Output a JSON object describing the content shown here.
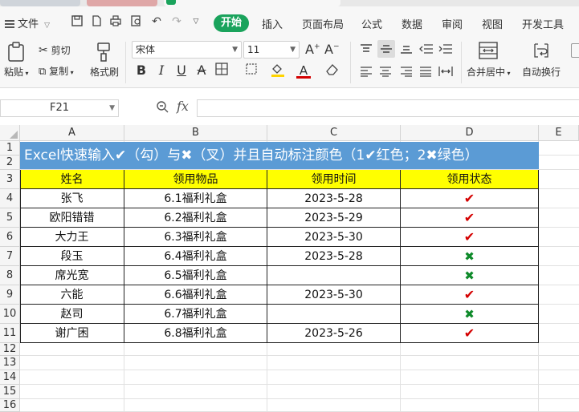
{
  "menu": {
    "file": "文件",
    "items": [
      "插入",
      "页面布局",
      "公式",
      "数据",
      "审阅",
      "视图",
      "开发工具"
    ],
    "active": "开始"
  },
  "ribbon": {
    "paste": "粘贴",
    "cut": "剪切",
    "copy": "复制",
    "format_painter": "格式刷",
    "font_name": "宋体",
    "font_size": "11",
    "merge_center": "合并居中",
    "wrap_text": "自动换行"
  },
  "formula_bar": {
    "name_box": "F21",
    "fx": "fx",
    "value": ""
  },
  "columns": [
    "A",
    "B",
    "C",
    "D",
    "E"
  ],
  "rows": [
    "1",
    "2",
    "3",
    "4",
    "5",
    "6",
    "7",
    "8",
    "9",
    "10",
    "11",
    "12",
    "13",
    "14",
    "15",
    "16"
  ],
  "sheet": {
    "title": "Excel快速输入✔（勾）与✖（叉）并且自动标注颜色（1✔红色；2✖绿色）",
    "headers": [
      "姓名",
      "领用物品",
      "领用时间",
      "领用状态"
    ],
    "records": [
      {
        "name": "张飞",
        "item": "6.1福利礼盒",
        "date": "2023-5-28",
        "status": "✔"
      },
      {
        "name": "欧阳错错",
        "item": "6.2福利礼盒",
        "date": "2023-5-29",
        "status": "✔"
      },
      {
        "name": "大力王",
        "item": "6.3福利礼盒",
        "date": "2023-5-30",
        "status": "✔"
      },
      {
        "name": "段玉",
        "item": "6.4福利礼盒",
        "date": "2023-5-28",
        "status": "✖"
      },
      {
        "name": "席光宽",
        "item": "6.5福利礼盒",
        "date": "",
        "status": "✖"
      },
      {
        "name": "六能",
        "item": "6.6福利礼盒",
        "date": "2023-5-30",
        "status": "✔"
      },
      {
        "name": "赵司",
        "item": "6.7福利礼盒",
        "date": "",
        "status": "✖"
      },
      {
        "name": "谢广困",
        "item": "6.8福利礼盒",
        "date": "2023-5-26",
        "status": "✔"
      }
    ]
  },
  "colors": {
    "accent": "#1aa35c",
    "title_fill": "#5b9bd5",
    "header_fill": "#ffff00",
    "check": "#d40000",
    "cross": "#0e8a2a"
  }
}
